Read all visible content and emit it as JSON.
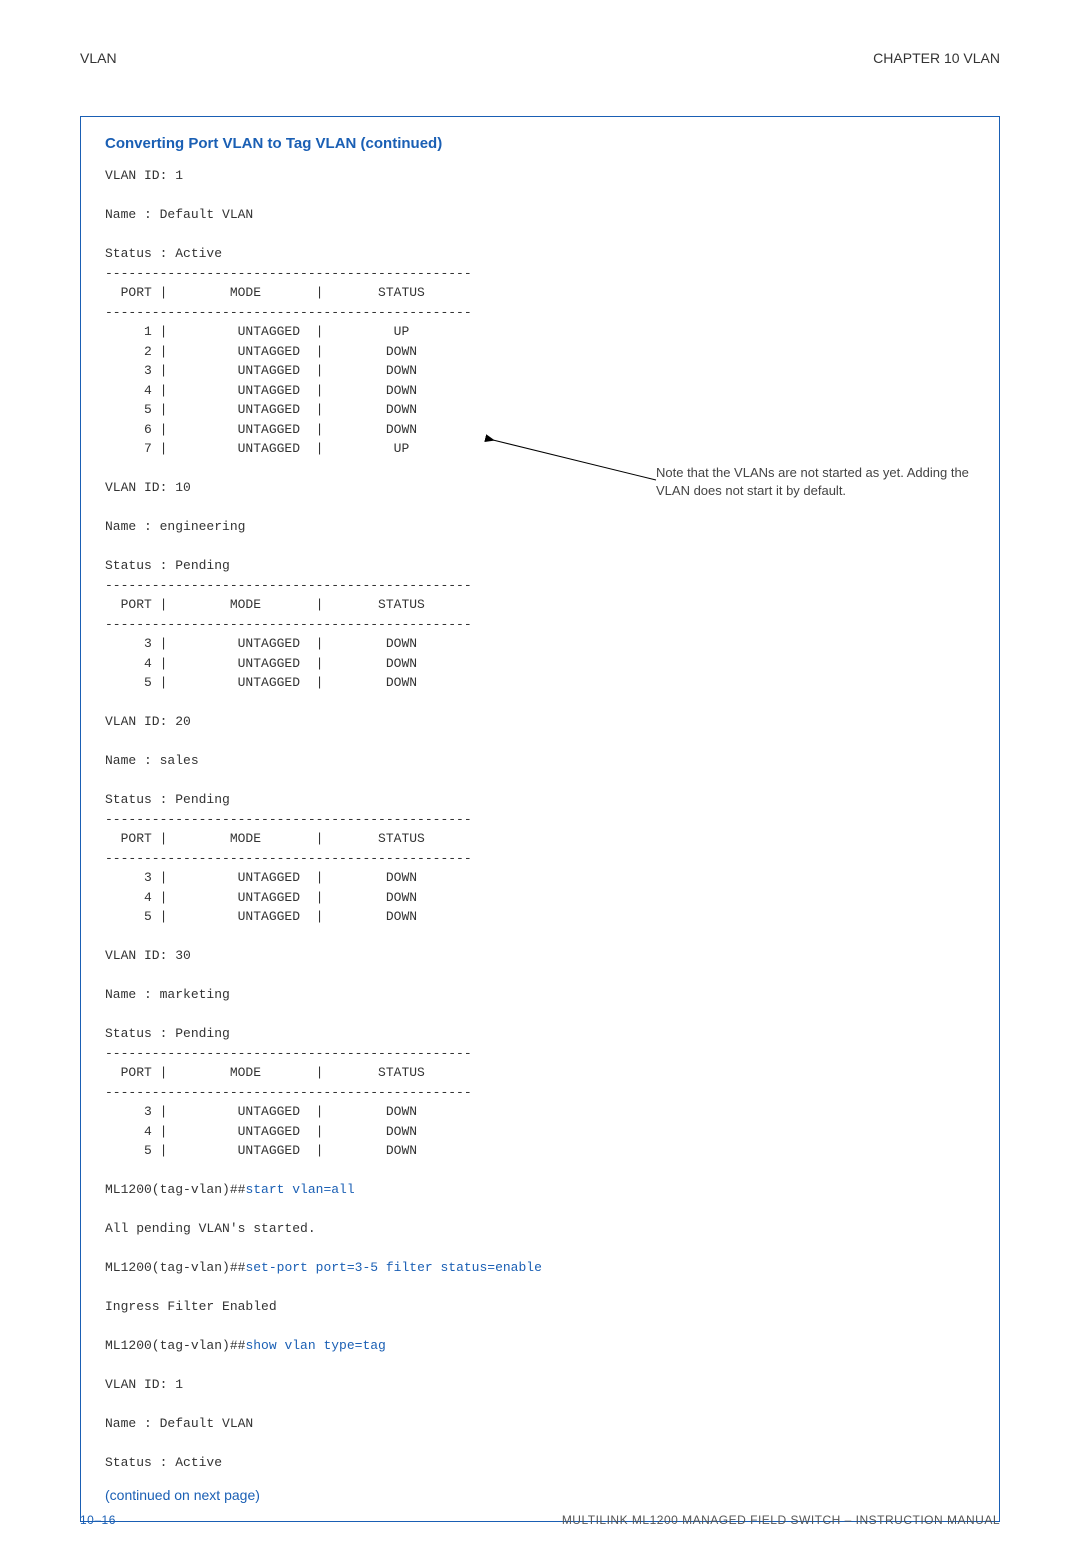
{
  "header": {
    "left": "VLAN",
    "right": "CHAPTER 10  VLAN"
  },
  "box": {
    "title": "Converting Port VLAN to Tag VLAN (continued)",
    "v1": {
      "id": "VLAN ID: 1",
      "name": "Name : Default VLAN",
      "status": "Status : Active",
      "hdr": "  PORT |        MODE       |       STATUS",
      "rows": [
        "     1 |         UNTAGGED  |         UP",
        "     2 |         UNTAGGED  |        DOWN",
        "     3 |         UNTAGGED  |        DOWN",
        "     4 |         UNTAGGED  |        DOWN",
        "     5 |         UNTAGGED  |        DOWN",
        "     6 |         UNTAGGED  |        DOWN",
        "     7 |         UNTAGGED  |         UP"
      ]
    },
    "v10": {
      "id": "VLAN ID: 10",
      "name": "Name : engineering",
      "status": "Status : Pending",
      "hdr": "  PORT |        MODE       |       STATUS",
      "rows": [
        "     3 |         UNTAGGED  |        DOWN",
        "     4 |         UNTAGGED  |        DOWN",
        "     5 |         UNTAGGED  |        DOWN"
      ]
    },
    "v20": {
      "id": "VLAN ID: 20",
      "name": "Name : sales",
      "status": "Status : Pending",
      "hdr": "  PORT |        MODE       |       STATUS",
      "rows": [
        "     3 |         UNTAGGED  |        DOWN",
        "     4 |         UNTAGGED  |        DOWN",
        "     5 |         UNTAGGED  |        DOWN"
      ]
    },
    "v30": {
      "id": "VLAN ID: 30",
      "name": "Name : marketing",
      "status": "Status : Pending",
      "hdr": "  PORT |        MODE       |       STATUS",
      "rows": [
        "     3 |         UNTAGGED  |        DOWN",
        "     4 |         UNTAGGED  |        DOWN",
        "     5 |         UNTAGGED  |        DOWN"
      ]
    },
    "dash": "-----------------------------------------------",
    "cmd1_pre": "ML1200(tag-vlan)##",
    "cmd1": "start vlan=all",
    "resp1": "All pending VLAN's started.",
    "cmd2_pre": "ML1200(tag-vlan)##",
    "cmd2": "set-port port=3-5 filter status=enable",
    "resp2": "Ingress Filter Enabled",
    "cmd3_pre": "ML1200(tag-vlan)##",
    "cmd3": "show vlan type=tag",
    "vend": {
      "id": "VLAN ID: 1",
      "name": "Name : Default VLAN",
      "status": "Status : Active"
    },
    "continued": "(continued on next page)"
  },
  "annotation": "Note that the VLANs are not started as yet. Adding the VLAN does not start it by default.",
  "footer": {
    "left": "10–16",
    "right": "MULTILINK ML1200 MANAGED FIELD SWITCH – INSTRUCTION MANUAL"
  }
}
